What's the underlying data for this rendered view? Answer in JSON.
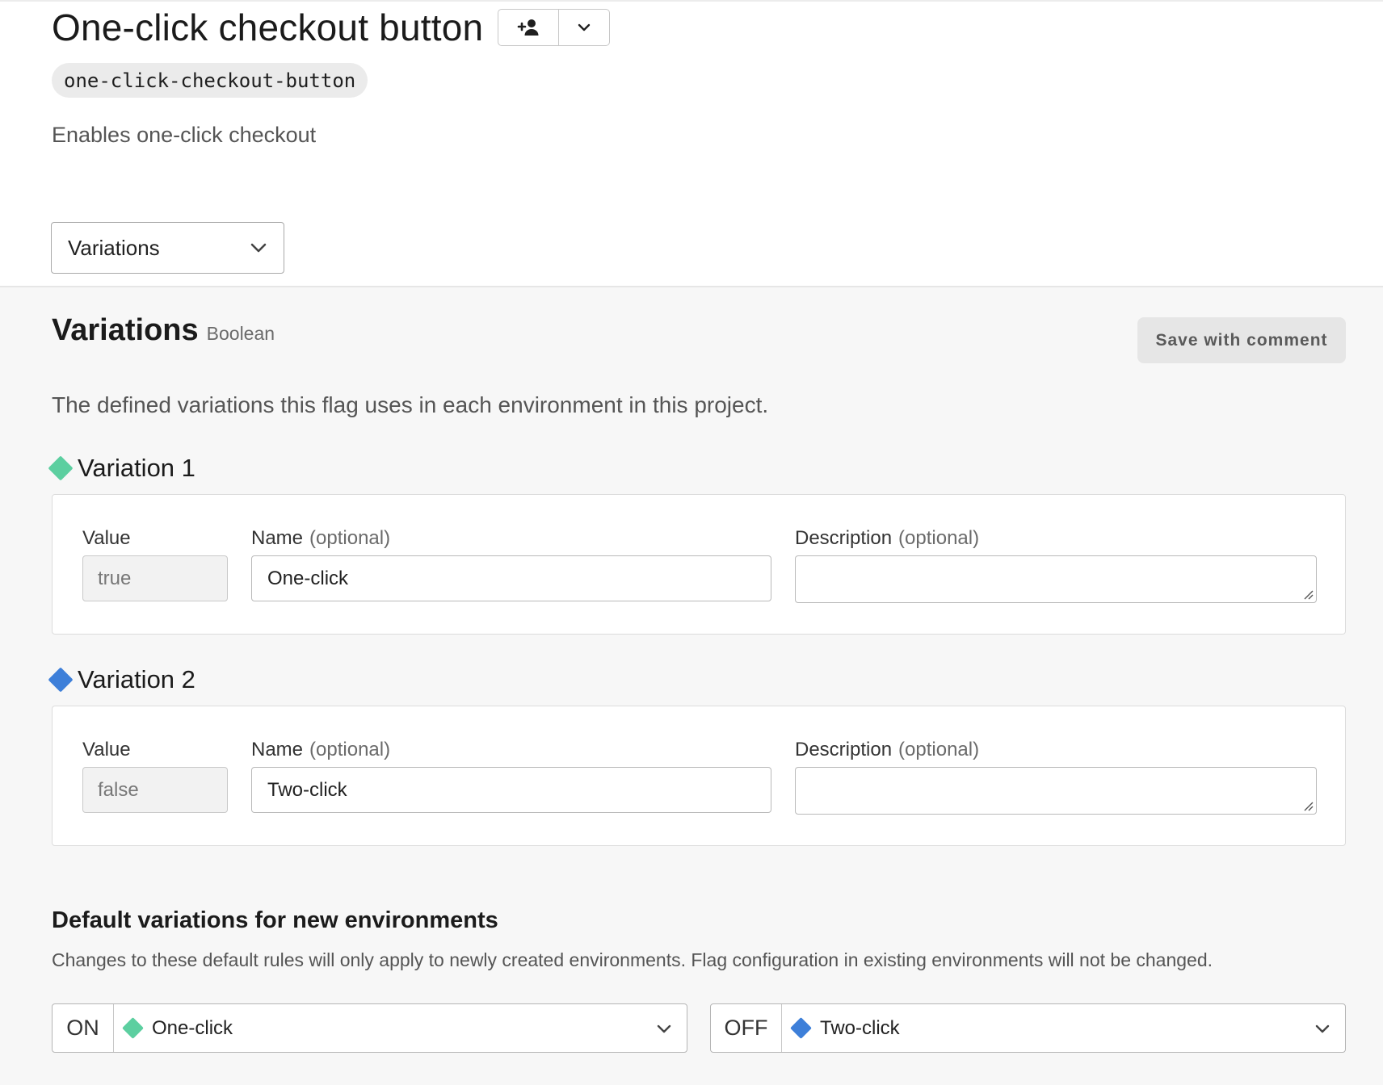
{
  "flag": {
    "title": "One-click checkout button",
    "key": "one-click-checkout-button",
    "description": "Enables one-click checkout",
    "view_select": "Variations"
  },
  "section": {
    "title": "Variations",
    "type": "Boolean",
    "save_label": "Save with comment",
    "description": "The defined variations this flag uses in each environment in this project."
  },
  "labels": {
    "value": "Value",
    "name": "Name",
    "description": "Description",
    "optional": "(optional)"
  },
  "variations": [
    {
      "label": "Variation 1",
      "value": "true",
      "name": "One-click",
      "description": "",
      "color": "#5ccfa0"
    },
    {
      "label": "Variation 2",
      "value": "false",
      "name": "Two-click",
      "description": "",
      "color": "#3d7fd9"
    }
  ],
  "defaults": {
    "title": "Default variations for new environments",
    "description": "Changes to these default rules will only apply to newly created environments. Flag configuration in existing environments will not be changed.",
    "on": {
      "state": "ON",
      "variation": "One-click"
    },
    "off": {
      "state": "OFF",
      "variation": "Two-click"
    }
  },
  "icons": {
    "add_user": "add-user-icon",
    "chevron": "chevron-down-icon",
    "variation_marker": "diamond-icon"
  }
}
